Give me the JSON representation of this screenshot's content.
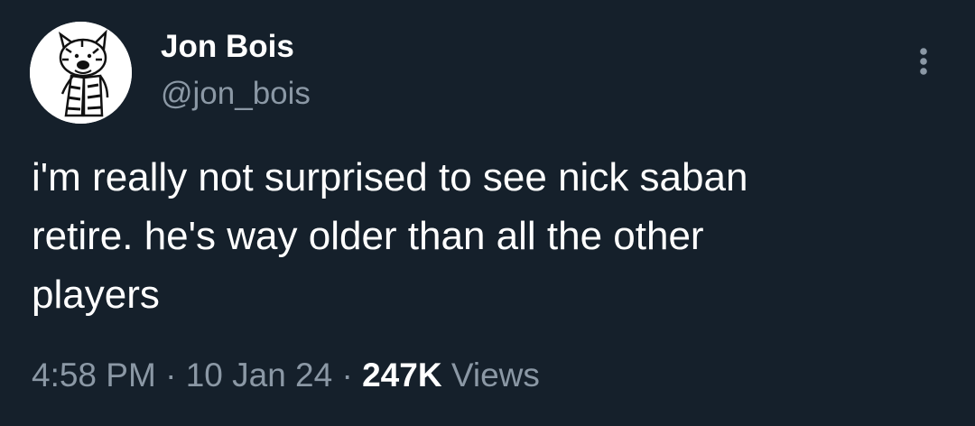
{
  "author": {
    "display_name": "Jon Bois",
    "handle": "@jon_bois",
    "avatar_icon": "calvin-and-hobbes-avatar-icon"
  },
  "tweet": {
    "text": "i'm really not surprised to see nick saban\nretire. he's way older than all the other\nplayers"
  },
  "meta": {
    "time": "4:58 PM",
    "separator": "·",
    "date": "10 Jan 24",
    "views_count": "247K",
    "views_label": "Views"
  },
  "colors": {
    "background": "#15202b",
    "primary_text": "#ffffff",
    "secondary_text": "#8b98a5"
  },
  "icons": {
    "more": "more-vertical-icon"
  }
}
